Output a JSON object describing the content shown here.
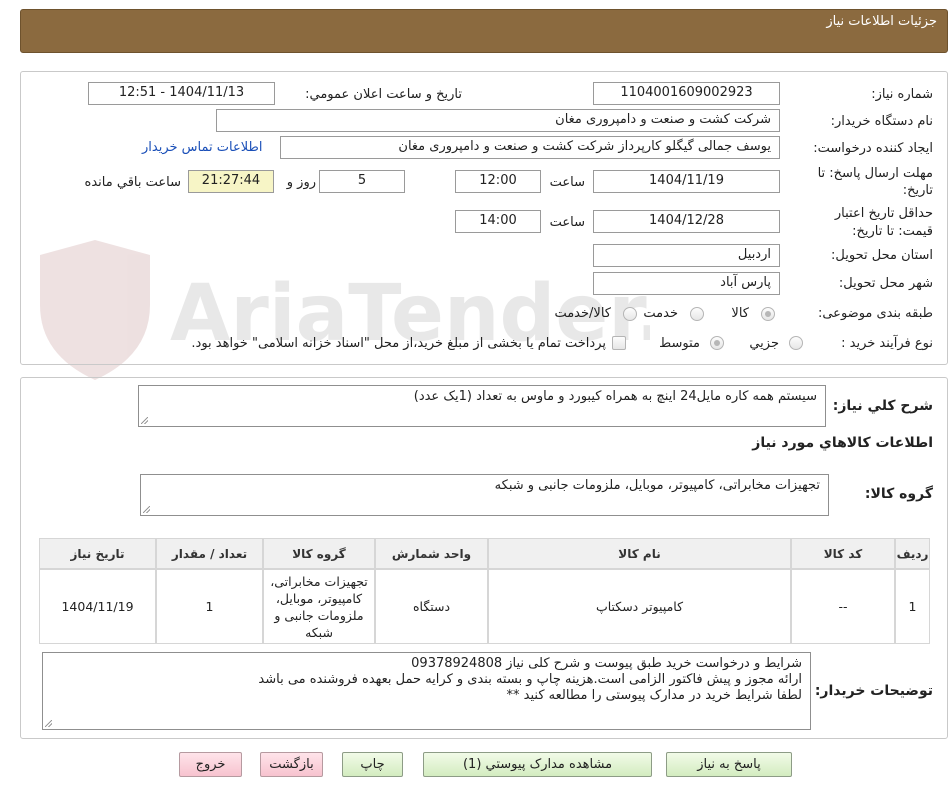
{
  "header": {
    "title": "جزئيات اطلاعات نياز"
  },
  "fields": {
    "need_number_label": "شماره نياز:",
    "need_number": "1104001609002923",
    "announce_label": "تاريخ و ساعت اعلان عمومي:",
    "announce_value": "1404/11/13 - 12:51",
    "buyer_label": "نام دستگاه خريدار:",
    "buyer_value": "شرکت کشت و صنعت و دامپروری مغان",
    "creator_label": "ايجاد کننده درخواست:",
    "creator_value": "یوسف جمالی گیگلو کارپرداز شرکت کشت و صنعت و دامپروری مغان",
    "contact_link": "اطلاعات تماس خريدار",
    "deadline_label_1": "مهلت ارسال پاسخ: تا",
    "deadline_label_2": "تاريخ:",
    "deadline_date": "1404/11/19",
    "time_label": "ساعت",
    "deadline_time": "12:00",
    "days_value": "5",
    "days_label": "روز و",
    "remaining_time": "21:27:44",
    "remaining_label": "ساعت باقي مانده",
    "validity_label_1": "حداقل تاريخ اعتبار",
    "validity_label_2": "قيمت: تا تاريخ:",
    "validity_date": "1404/12/28",
    "validity_time": "14:00",
    "province_label": "استان محل تحويل:",
    "province_value": "اردبیل",
    "city_label": "شهر محل تحويل:",
    "city_value": "پارس آباد",
    "category_label": "طبقه بندی موضوعی:",
    "category_options": [
      "کالا",
      "خدمت",
      "کالا/خدمت"
    ],
    "process_label": "نوع فرآيند خريد :",
    "process_options": [
      "جزيي",
      "متوسط"
    ],
    "payment_note": "پرداخت تمام يا بخشی از مبلغ خريد،از محل \"اسناد خزانه اسلامی\" خواهد بود."
  },
  "description": {
    "label": "شرح کلي نياز:",
    "value": "سیستم همه کاره مایل24 اینچ به همراه کیبورد و ماوس به تعداد (1یک عدد)"
  },
  "goods": {
    "section_title": "اطلاعات کالاهاي مورد نياز",
    "group_label": "گروه کالا:",
    "group_value": "تجهیزات مخابراتی، کامپیوتر، موبایل، ملزومات جانبی و شبکه",
    "table": {
      "headers": [
        "رديف",
        "کد کالا",
        "نام کالا",
        "واحد شمارش",
        "گروه کالا",
        "تعداد / مقدار",
        "تاريخ نياز"
      ],
      "rows": [
        [
          "1",
          "--",
          "کامپیوتر دسکتاپ",
          "دستگاه",
          "تجهیزات مخابراتی، کامپیوتر، موبایل، ملزومات جانبی و شبکه",
          "1",
          "1404/11/19"
        ]
      ]
    }
  },
  "buyer_notes": {
    "label": "توضيحات خريدار:",
    "lines": [
      "شرایط و درخواست خرید طبق پیوست و شرح کلی نیاز 09378924808",
      "ارائه مجوز و پیش فاکتور الزامی است.هزینه چاپ و بسته بندی و کرایه حمل بعهده فروشنده می باشد",
      "لطفا شرایط خرید در مدارک پیوستی را مطالعه کنید **"
    ]
  },
  "buttons": {
    "respond": "پاسخ به نياز",
    "attachments": "مشاهده مدارک پيوستي (1)",
    "print": "چاپ",
    "back": "بازگشت",
    "exit": "خروج"
  },
  "watermark": {
    "text": "AriaTender.neT"
  },
  "colors": {
    "header": "#8b6a3f",
    "highlight": "#f7f5c6",
    "link": "#1a4fb8"
  }
}
